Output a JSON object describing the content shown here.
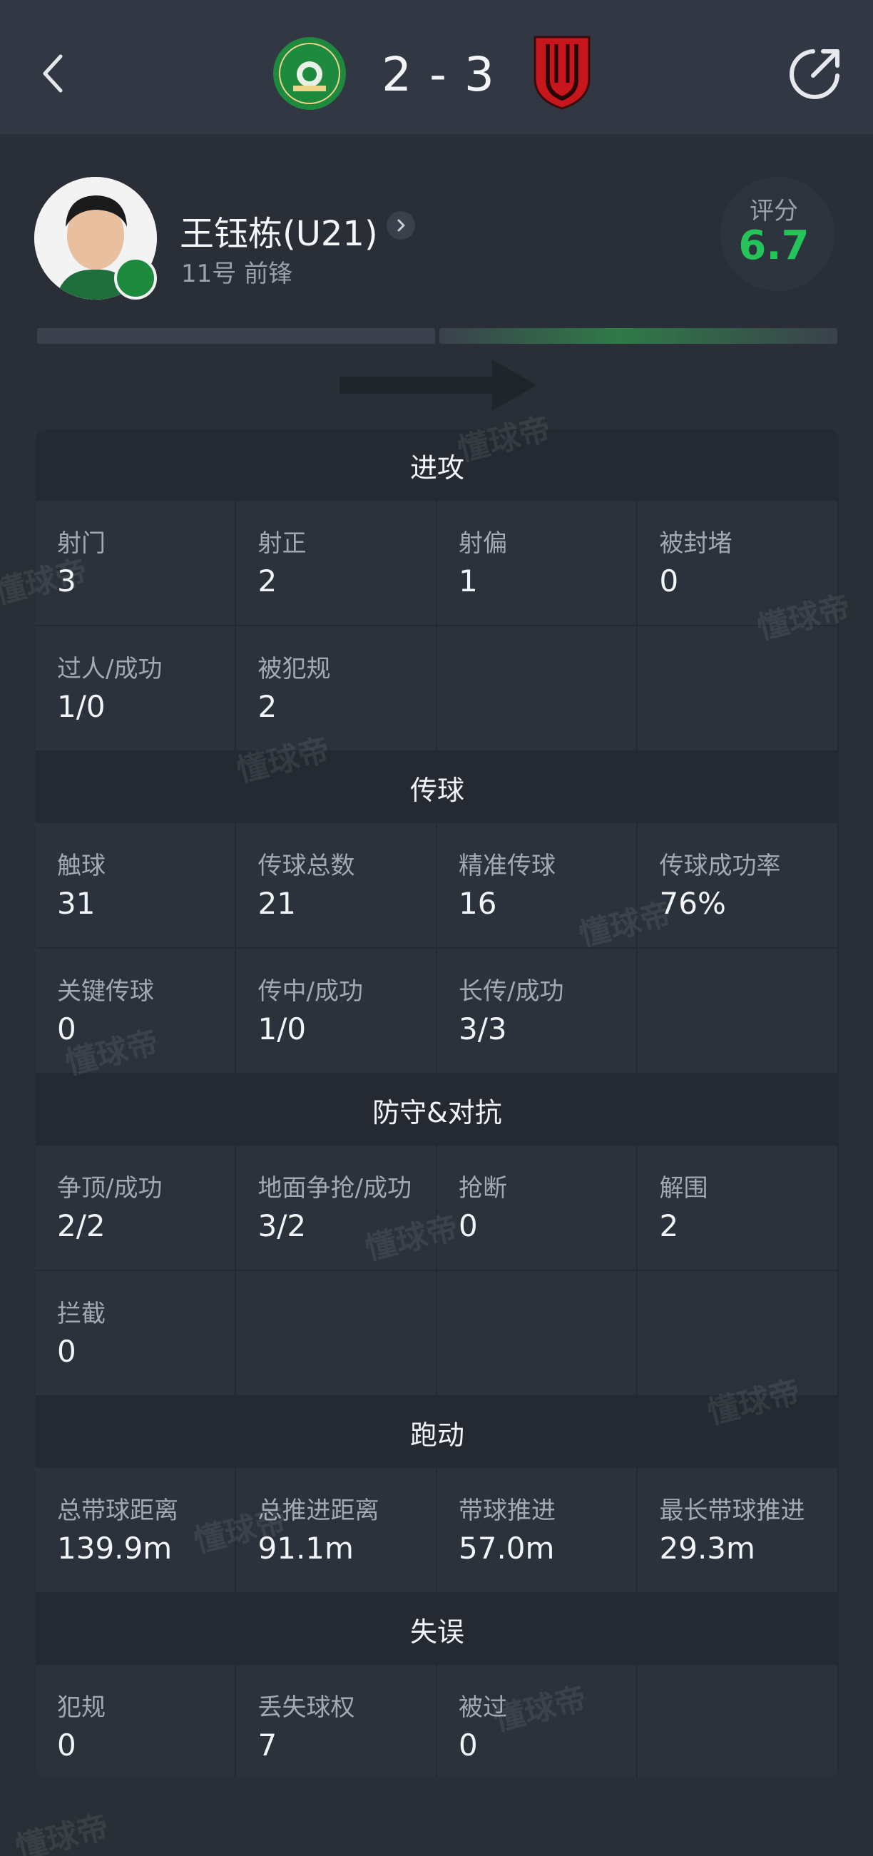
{
  "header": {
    "score": "2 - 3",
    "home_logo_text": "ZHEJIANG FOOTBALL CLUB"
  },
  "player": {
    "name": "王钰栋(U21)",
    "sub": "11号 前锋",
    "rating_label": "评分",
    "rating_value": "6.7"
  },
  "sections": [
    {
      "title": "进攻",
      "stats": [
        {
          "label": "射门",
          "value": "3"
        },
        {
          "label": "射正",
          "value": "2"
        },
        {
          "label": "射偏",
          "value": "1"
        },
        {
          "label": "被封堵",
          "value": "0"
        },
        {
          "label": "过人/成功",
          "value": "1/0"
        },
        {
          "label": "被犯规",
          "value": "2"
        },
        {
          "label": "",
          "value": ""
        },
        {
          "label": "",
          "value": ""
        }
      ]
    },
    {
      "title": "传球",
      "stats": [
        {
          "label": "触球",
          "value": "31"
        },
        {
          "label": "传球总数",
          "value": "21"
        },
        {
          "label": "精准传球",
          "value": "16"
        },
        {
          "label": "传球成功率",
          "value": "76%"
        },
        {
          "label": "关键传球",
          "value": "0"
        },
        {
          "label": "传中/成功",
          "value": "1/0"
        },
        {
          "label": "长传/成功",
          "value": "3/3"
        },
        {
          "label": "",
          "value": ""
        }
      ]
    },
    {
      "title": "防守&对抗",
      "stats": [
        {
          "label": "争顶/成功",
          "value": "2/2"
        },
        {
          "label": "地面争抢/成功",
          "value": "3/2"
        },
        {
          "label": "抢断",
          "value": "0"
        },
        {
          "label": "解围",
          "value": "2"
        },
        {
          "label": "拦截",
          "value": "0"
        },
        {
          "label": "",
          "value": ""
        },
        {
          "label": "",
          "value": ""
        },
        {
          "label": "",
          "value": ""
        }
      ]
    },
    {
      "title": "跑动",
      "stats": [
        {
          "label": "总带球距离",
          "value": "139.9m"
        },
        {
          "label": "总推进距离",
          "value": "91.1m"
        },
        {
          "label": "带球推进",
          "value": "57.0m"
        },
        {
          "label": "最长带球推进",
          "value": "29.3m"
        }
      ]
    },
    {
      "title": "失误",
      "stats": [
        {
          "label": "犯规",
          "value": "0"
        },
        {
          "label": "丢失球权",
          "value": "7"
        },
        {
          "label": "被过",
          "value": "0"
        },
        {
          "label": "",
          "value": ""
        }
      ]
    }
  ],
  "watermark": "懂球帝",
  "colors": {
    "accent_green": "#24c45a",
    "away_red": "#c8161d",
    "home_green": "#1e8a3e"
  },
  "icons": [
    "back-icon",
    "home-team-logo",
    "away-team-logo",
    "share-icon",
    "chevron-right-icon",
    "direction-arrow-icon"
  ]
}
